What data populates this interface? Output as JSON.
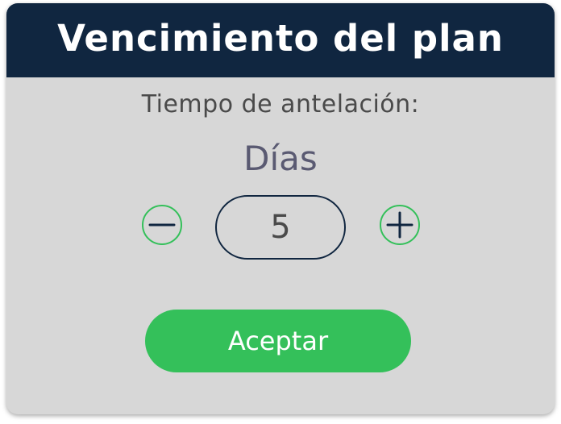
{
  "header": {
    "title": "Vencimiento del plan"
  },
  "prompt": {
    "label": "Tiempo de antelación:"
  },
  "stepper": {
    "unit_label": "Días",
    "value": "5",
    "decrement_icon": "minus-icon",
    "increment_icon": "plus-icon"
  },
  "actions": {
    "accept_label": "Aceptar"
  },
  "colors": {
    "header_bg": "#102640",
    "dialog_bg": "#d7d7d7",
    "accent_green": "#34c05a"
  }
}
